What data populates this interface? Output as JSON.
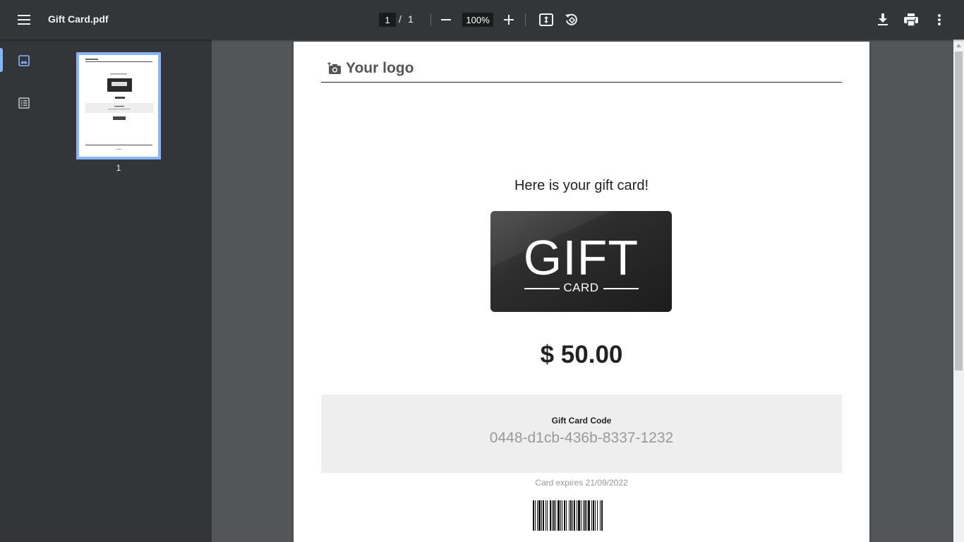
{
  "toolbar": {
    "title": "Gift Card.pdf",
    "current_page": "1",
    "page_separator": "/",
    "total_pages": "1",
    "zoom": "100%",
    "icons": [
      "menu-icon",
      "zoom-out-icon",
      "zoom-in-icon",
      "fit-page-icon",
      "rotate-icon",
      "download-icon",
      "print-icon",
      "more-icon"
    ]
  },
  "sidebar": {
    "tabs": [
      {
        "name": "thumbnails",
        "icon": "image-icon",
        "active": true
      },
      {
        "name": "outline",
        "icon": "outline-icon",
        "active": false
      }
    ],
    "thumbnail_label": "1",
    "accent": "#8ab4f8"
  },
  "document": {
    "logo_text": "Your logo",
    "greeting": "Here is your gift card!",
    "card_big": "GIFT",
    "card_small": "CARD",
    "amount": "$ 50.00",
    "code_label": "Gift Card Code",
    "code_value": "0448-d1cb-436b-8337-1232",
    "expires": "Card expires 21/09/2022"
  }
}
